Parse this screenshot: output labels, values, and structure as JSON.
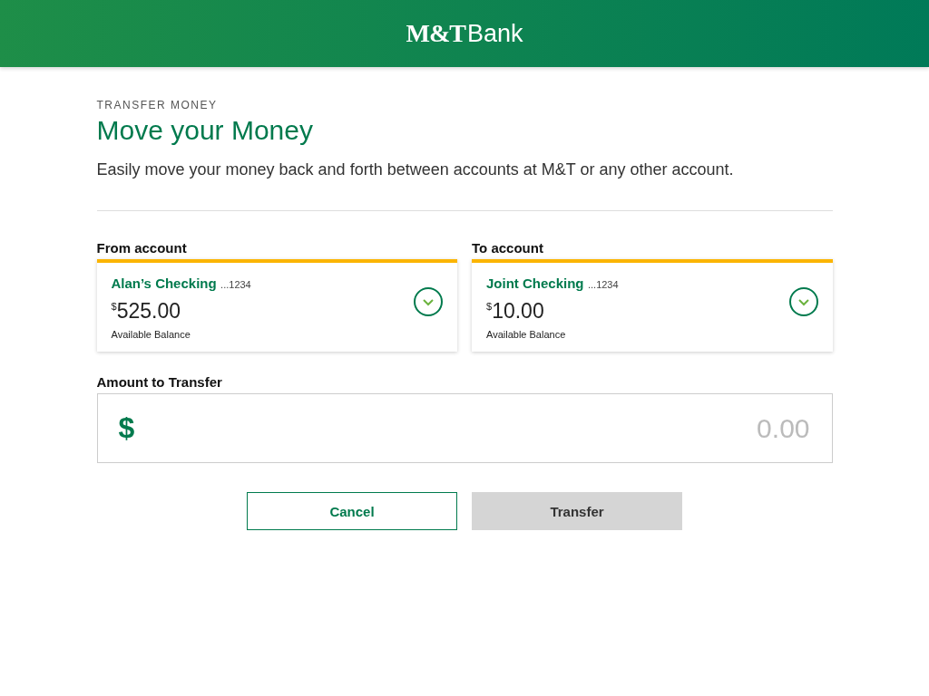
{
  "header": {
    "logo_mark": "M&T",
    "logo_word": "Bank"
  },
  "eyebrow": "TRANSFER MONEY",
  "title": "Move your Money",
  "intro": "Easily move your money back and forth between accounts at M&T or any other account.",
  "accounts": [
    {
      "label": "From account",
      "name": "Alan’s Checking",
      "number": "...1234",
      "currency": "$",
      "balance": "525.00",
      "balance_label": "Available Balance"
    },
    {
      "label": "To account",
      "name": "Joint Checking",
      "number": "...1234",
      "currency": "$",
      "balance": "10.00",
      "balance_label": "Available Balance"
    }
  ],
  "amount": {
    "label": "Amount to Transfer",
    "currency": "$",
    "placeholder": "0.00"
  },
  "buttons": [
    {
      "label": "Cancel",
      "kind": "secondary",
      "disabled": false
    },
    {
      "label": "Transfer",
      "kind": "primary",
      "disabled": true
    }
  ]
}
